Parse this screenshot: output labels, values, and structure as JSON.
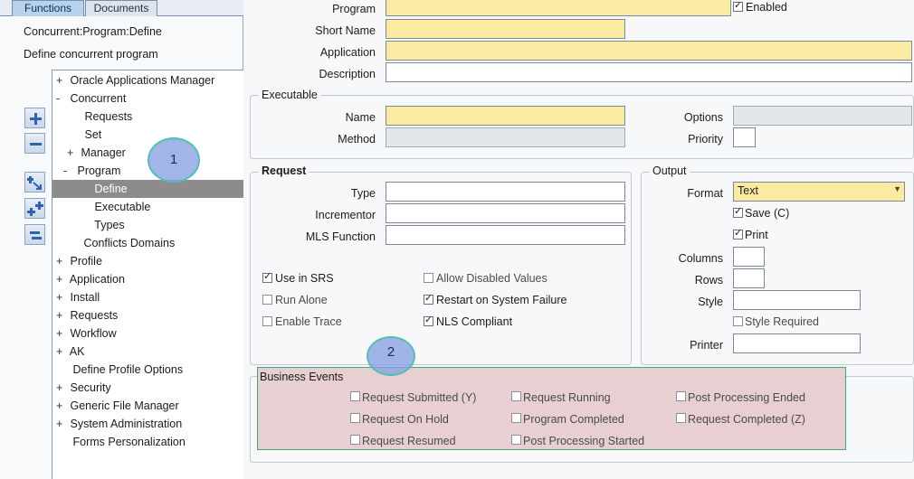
{
  "nav": {
    "tabs": [
      {
        "label": "Functions",
        "active": true
      },
      {
        "label": "Documents",
        "active": false
      }
    ],
    "function_name": "Concurrent:Program:Define",
    "function_description": "Define concurrent program",
    "tree": [
      {
        "toggle": "+",
        "label": "Oracle Applications Manager"
      },
      {
        "toggle": "-",
        "label": "Concurrent"
      },
      {
        "toggle": "",
        "label": "Requests"
      },
      {
        "toggle": "",
        "label": "Set"
      },
      {
        "toggle": "+",
        "label": "Manager"
      },
      {
        "toggle": "-",
        "label": "Program"
      },
      {
        "toggle": "",
        "label": "Define",
        "selected": true
      },
      {
        "toggle": "",
        "label": "Executable"
      },
      {
        "toggle": "",
        "label": "Types"
      },
      {
        "toggle": "",
        "label": "Conflicts Domains"
      },
      {
        "toggle": "+",
        "label": "Profile"
      },
      {
        "toggle": "+",
        "label": "Application"
      },
      {
        "toggle": "+",
        "label": "Install"
      },
      {
        "toggle": "+",
        "label": "Requests"
      },
      {
        "toggle": "+",
        "label": "Workflow"
      },
      {
        "toggle": "+",
        "label": "AK"
      },
      {
        "toggle": "",
        "label": "Define Profile Options"
      },
      {
        "toggle": "+",
        "label": "Security"
      },
      {
        "toggle": "+",
        "label": "Generic File Manager"
      },
      {
        "toggle": "+",
        "label": "System Administration"
      },
      {
        "toggle": "",
        "label": "Forms Personalization"
      }
    ],
    "toolbar_icons": [
      "expand-icon",
      "collapse-icon",
      "expand-branch-icon",
      "expand-all-icon",
      "collapse-all-icon"
    ]
  },
  "callouts": [
    "1",
    "2"
  ],
  "form": {
    "program_label": "Program",
    "program_value": "",
    "enabled_label": "Enabled",
    "enabled_checked": true,
    "short_name_label": "Short Name",
    "short_name_value": "",
    "application_label": "Application",
    "application_value": "",
    "description_label": "Description",
    "description_value": ""
  },
  "executable": {
    "title": "Executable",
    "name_label": "Name",
    "name_value": "",
    "method_label": "Method",
    "method_value": "",
    "options_label": "Options",
    "options_value": "",
    "priority_label": "Priority",
    "priority_value": ""
  },
  "request": {
    "title": "Request",
    "type_label": "Type",
    "incrementor_label": "Incrementor",
    "mls_label": "MLS Function",
    "checkboxes": [
      {
        "label": "Use in SRS",
        "checked": true
      },
      {
        "label": "Allow Disabled Values",
        "checked": false
      },
      {
        "label": "Run Alone",
        "checked": false
      },
      {
        "label": "Restart on System Failure",
        "checked": true
      },
      {
        "label": "Enable Trace",
        "checked": false
      },
      {
        "label": "NLS Compliant",
        "checked": true
      }
    ]
  },
  "output": {
    "title": "Output",
    "format_label": "Format",
    "format_value": "Text",
    "save_label": "Save (C)",
    "save_checked": true,
    "print_label": "Print",
    "print_checked": true,
    "columns_label": "Columns",
    "rows_label": "Rows",
    "style_label": "Style",
    "style_required_label": "Style Required",
    "style_required_checked": false,
    "printer_label": "Printer"
  },
  "business_events": {
    "title": "Business Events",
    "items": [
      {
        "label": "Request Submitted (Y)",
        "checked": false
      },
      {
        "label": "Request Running",
        "checked": false
      },
      {
        "label": "Post Processing Ended",
        "checked": false
      },
      {
        "label": "Request On Hold",
        "checked": false
      },
      {
        "label": "Program Completed",
        "checked": false
      },
      {
        "label": "Request Completed (Z)",
        "checked": false
      },
      {
        "label": "Request Resumed",
        "checked": false
      },
      {
        "label": "Post Processing Started",
        "checked": false
      }
    ]
  },
  "colors": {
    "required_field": "#fbeaa2",
    "selected_node": "#8c8c8c",
    "active_tab": "#b9d2ec",
    "callout_fill": "#87a0e1",
    "business_events_highlight": "#e7cfd2"
  }
}
